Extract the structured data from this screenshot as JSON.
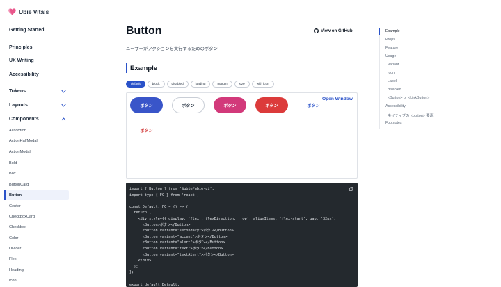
{
  "brand": {
    "name": "Ubie Vitals",
    "logo_icon": "heart-icon",
    "logo_color": "#e9568b"
  },
  "sidebar": {
    "main_items": [
      "Getting Started",
      "Principles",
      "UX Writing",
      "Accessibility"
    ],
    "groups": [
      "Tokens",
      "Layouts",
      "Components"
    ],
    "components": [
      "Accordion",
      "ActionHalfModal",
      "ActionModal",
      "Bold",
      "Box",
      "ButtonCard",
      "Button",
      "Center",
      "CheckboxCard",
      "Checkbox",
      "Color",
      "Divider",
      "Flex",
      "Heading",
      "Icon"
    ],
    "active_component": "Button"
  },
  "page": {
    "title": "Button",
    "subtitle": "ユーザーがアクションを実行するためのボタン",
    "github_link": "View on GitHub",
    "section_title": "Example"
  },
  "tabs": [
    "default",
    "block",
    "disabled",
    "loading",
    "margin",
    "size",
    "with icon"
  ],
  "active_tab": "default",
  "preview": {
    "open_window": "Open Window",
    "buttons": {
      "primary": "ボタン",
      "secondary": "ボタン",
      "accent": "ボタン",
      "alert": "ボタン",
      "text": "ボタン",
      "textAlert": "ボタン"
    }
  },
  "code": {
    "copy_icon": "copy-icon",
    "lines": [
      "import { Button } from '@ubie/ubie-ui';",
      "import type { FC } from 'react';",
      "",
      "const Default: FC = () => (",
      "  return (",
      "    <div style={{ display: 'flex', flexDirection: 'row', alignItems: 'flex-start', gap: '32px',",
      "      <Button>ボタン</Button>",
      "      <Button variant=\"secondary\">ボタン</Button>",
      "      <Button variant=\"accent\">ボタン</Button>",
      "      <Button variant=\"alert\">ボタン</Button>",
      "      <Button variant=\"text\">ボタン</Button>",
      "      <Button variant=\"textAlert\">ボタン</Button>",
      "    </div>",
      "  );",
      "};",
      "",
      "export default Default;"
    ]
  },
  "toc": {
    "items": [
      "Example",
      "Props",
      "Feature",
      "Usage",
      "Variant",
      "Icon",
      "Label",
      "disabled",
      "<Button> or <LinkButton>",
      "Accessibility",
      "ネイティブの <button> 要素",
      "Footnotes"
    ],
    "active": "Example"
  },
  "colors": {
    "accent_blue": "#2a52c9",
    "accent_pink": "#d2397a",
    "alert_red": "#dc3b3b",
    "code_bg": "#24292e"
  }
}
